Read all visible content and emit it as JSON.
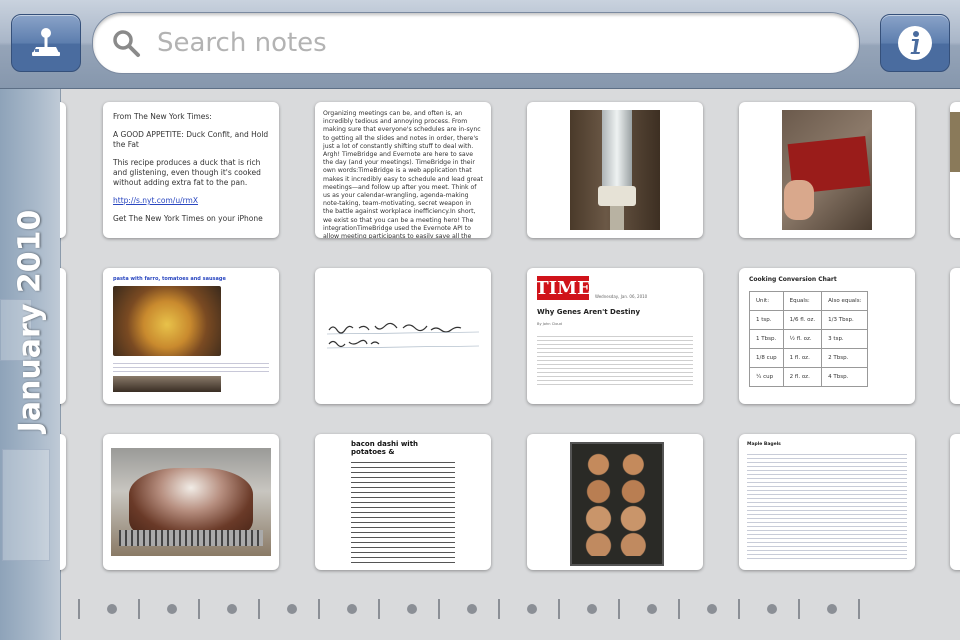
{
  "search": {
    "placeholder": "Search notes"
  },
  "timeline": {
    "month": "January 2010"
  },
  "notes": {
    "nyt": {
      "line1": "From The New York Times:",
      "line2": "A GOOD APPETITE: Duck Confit, and Hold the Fat",
      "line3": "This recipe produces a duck that is rich and glistening, even though it's cooked without adding extra fat to the pan.",
      "link": "http://s.nyt.com/u/rmX",
      "line4": "Get The New York Times on your iPhone"
    },
    "timebridge": {
      "text": "Organizing meetings can be, and often is, an incredibly tedious and annoying process. From making sure that everyone's schedules are in-sync to getting all the slides and notes in order, there's just a lot of constantly shifting stuff to deal with. Argh! TimeBridge and Evernote are here to save the day (and your meetings). TimeBridge in their own words:TimeBridge is a web application that makes it incredibly easy to schedule and lead great meetings—and follow up after you meet. Think of us as your calendar-wrangling, agenda-making note-taking, team-motivating, secret weapon in the battle against workplace inefficiency.In short, we exist so that you can be a meeting hero! The integrationTimeBridge used the Evernote API to allow meeting participants to easily save all the notes"
    },
    "pasta": {
      "title": "pasta with farro, tomatoes and sausage"
    },
    "time": {
      "logo": "TIME",
      "date": "Wednesday, Jan. 06, 2010",
      "headline": "Why Genes Aren't Destiny",
      "byline": "By John Cloud"
    },
    "conversion": {
      "title": "Cooking Conversion Chart",
      "headers": [
        "Unit:",
        "Equals:",
        "Also equals:"
      ],
      "rows": [
        [
          "1 tsp.",
          "1/6 fl. oz.",
          "1/3 Tbsp."
        ],
        [
          "1 Tbsp.",
          "½ fl. oz.",
          "3 tsp."
        ],
        [
          "1/8 cup",
          "1 fl. oz.",
          "2 Tbsp."
        ],
        [
          "¼ cup",
          "2 fl. oz.",
          "4 Tbsp."
        ]
      ]
    },
    "bacon": {
      "title": "bacon dashi with potatoes &"
    },
    "bagels_recipe": {
      "title": "Maple Bagels"
    }
  },
  "colors": {
    "topbar": "#9aa9bd",
    "button": "#5678aa",
    "timeline": "#a3b4c6",
    "time_red": "#d0131a",
    "link": "#2a47c0"
  },
  "icons": {
    "left_button": "joystick-icon",
    "search": "search-icon",
    "right_button": "info-icon"
  }
}
